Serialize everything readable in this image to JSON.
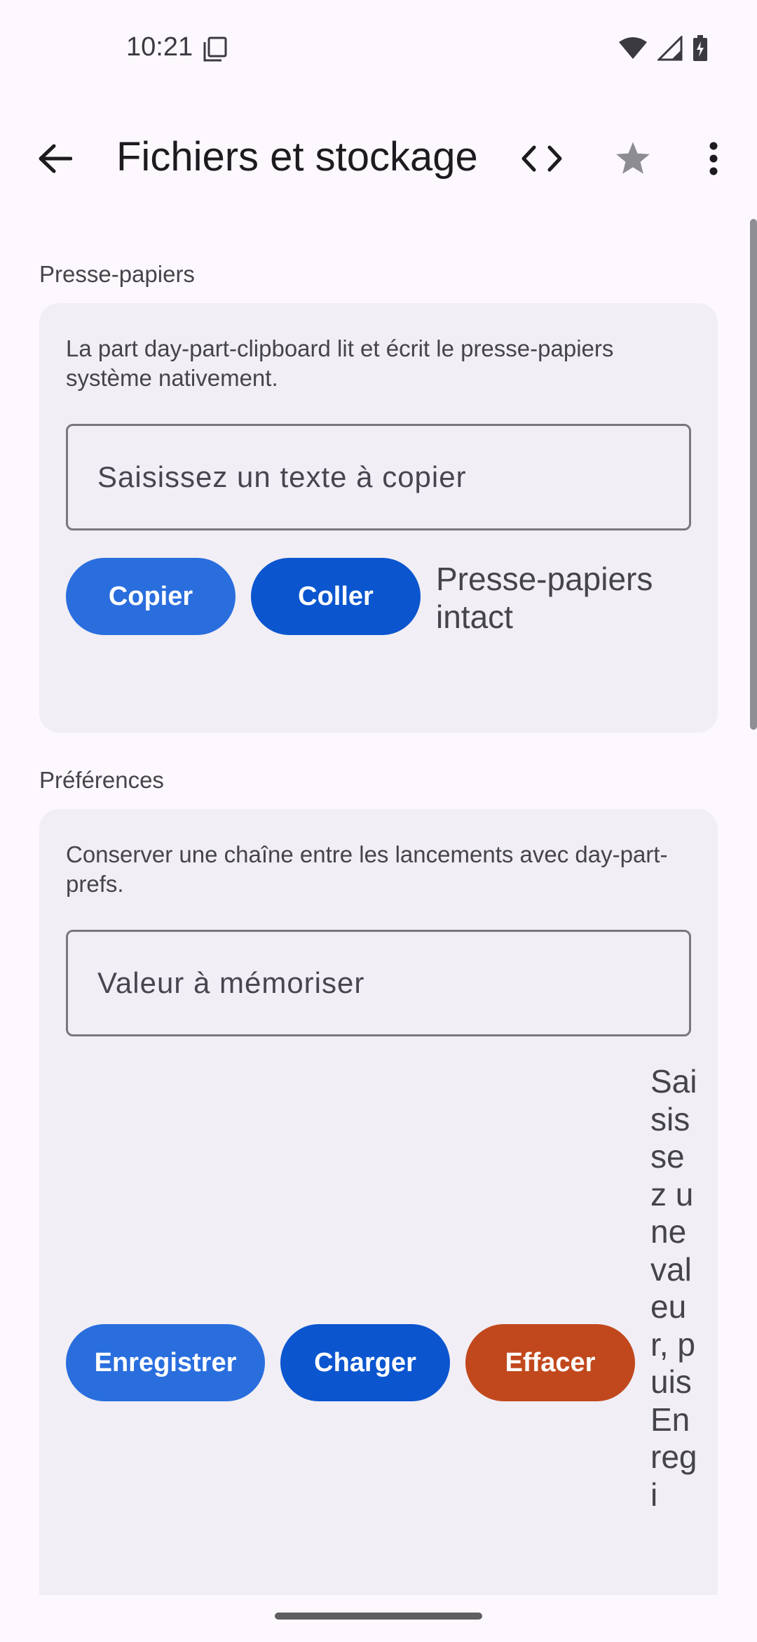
{
  "status_bar": {
    "time": "10:21",
    "icons": [
      "sim-card-icon",
      "wifi-icon",
      "cellular-signal-icon",
      "battery-charging-icon"
    ]
  },
  "app_bar": {
    "title": "Fichiers et stockage",
    "back_icon": "arrow-back-icon",
    "code_icon": "code-icon",
    "star_icon": "star-icon",
    "more_icon": "more-vert-icon"
  },
  "clipboard": {
    "section_label": "Presse-papiers",
    "description": "La part day-part-clipboard lit et écrit le presse-papiers système nativement.",
    "input_placeholder": "Saisissez un texte à copier",
    "input_value": "",
    "copy_label": "Copier",
    "paste_label": "Coller",
    "status": "Presse-papiers intact"
  },
  "preferences": {
    "section_label": "Préférences",
    "description": "Conserver une chaîne entre les lancements avec day-part-prefs.",
    "input_placeholder": "Valeur à mémoriser",
    "input_value": "",
    "save_label": "Enregistrer",
    "load_label": "Charger",
    "clear_label": "Effacer",
    "status": "Saisissez une valeur, puis Enregi"
  },
  "colors": {
    "primary": "#2a6ede",
    "primary_dark": "#0b55cf",
    "danger": "#c1481d",
    "card": "#f1eef5",
    "background": "#fdf8fd"
  }
}
